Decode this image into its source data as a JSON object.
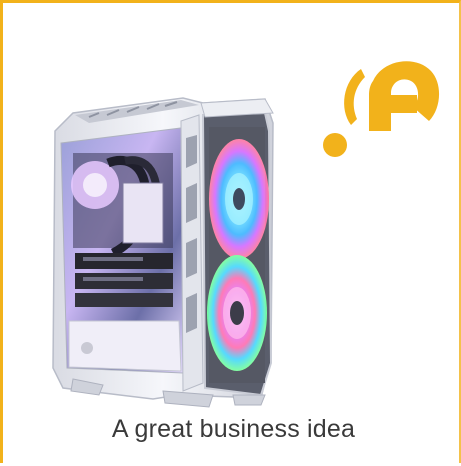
{
  "caption": "A great business idea",
  "colors": {
    "accent": "#f2b21b",
    "text": "#3a3a3a",
    "case": "#e9eaef"
  },
  "logo_icon": "brand-mark-icon",
  "product_image": "pc-case-rgb-fans-image"
}
